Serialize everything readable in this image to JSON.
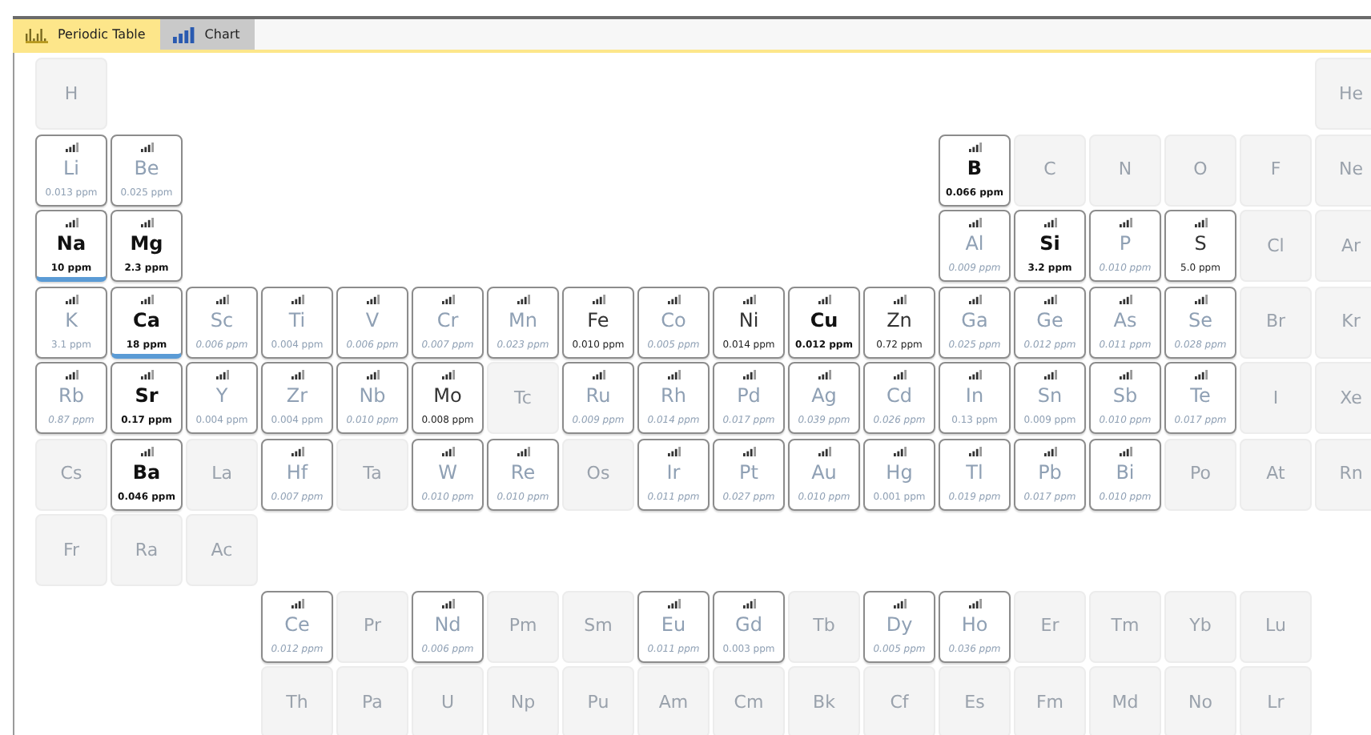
{
  "tabs": [
    {
      "label": "Periodic Table",
      "selected": true
    },
    {
      "label": "Chart",
      "selected": false
    }
  ],
  "periods": [
    {
      "left": [
        {
          "symbol": "H",
          "kind": "empty"
        }
      ],
      "right": [
        {
          "symbol": "He",
          "kind": "empty"
        }
      ]
    },
    {
      "left": [
        {
          "symbol": "Li",
          "kind": "plain",
          "value": "0.013 ppm"
        },
        {
          "symbol": "Be",
          "kind": "plain",
          "value": "0.025 ppm"
        }
      ],
      "right": [
        {
          "symbol": "B",
          "kind": "bold",
          "value": "0.066 ppm"
        },
        {
          "symbol": "C",
          "kind": "empty"
        },
        {
          "symbol": "N",
          "kind": "empty"
        },
        {
          "symbol": "O",
          "kind": "empty"
        },
        {
          "symbol": "F",
          "kind": "empty"
        },
        {
          "symbol": "Ne",
          "kind": "empty"
        }
      ]
    },
    {
      "left": [
        {
          "symbol": "Na",
          "kind": "bold",
          "value": "10 ppm",
          "highlighted": true
        },
        {
          "symbol": "Mg",
          "kind": "bold",
          "value": "2.3 ppm"
        }
      ],
      "right": [
        {
          "symbol": "Al",
          "kind": "trace",
          "value": "0.009 ppm"
        },
        {
          "symbol": "Si",
          "kind": "bold",
          "value": "3.2 ppm"
        },
        {
          "symbol": "P",
          "kind": "trace",
          "value": "0.010 ppm"
        },
        {
          "symbol": "S",
          "kind": "dark",
          "value": "5.0 ppm"
        },
        {
          "symbol": "Cl",
          "kind": "empty"
        },
        {
          "symbol": "Ar",
          "kind": "empty"
        }
      ]
    },
    {
      "left": [
        {
          "symbol": "K",
          "kind": "plain",
          "value": "3.1 ppm"
        },
        {
          "symbol": "Ca",
          "kind": "bold",
          "value": "18 ppm",
          "highlighted": true
        },
        {
          "symbol": "Sc",
          "kind": "trace",
          "value": "0.006 ppm"
        },
        {
          "symbol": "Ti",
          "kind": "plain",
          "value": "0.004 ppm"
        },
        {
          "symbol": "V",
          "kind": "trace",
          "value": "0.006 ppm"
        },
        {
          "symbol": "Cr",
          "kind": "trace",
          "value": "0.007 ppm"
        },
        {
          "symbol": "Mn",
          "kind": "trace",
          "value": "0.023 ppm"
        },
        {
          "symbol": "Fe",
          "kind": "dark",
          "value": "0.010 ppm"
        },
        {
          "symbol": "Co",
          "kind": "trace",
          "value": "0.005 ppm"
        },
        {
          "symbol": "Ni",
          "kind": "dark",
          "value": "0.014 ppm"
        },
        {
          "symbol": "Cu",
          "kind": "bold",
          "value": "0.012 ppm"
        },
        {
          "symbol": "Zn",
          "kind": "dark",
          "value": "0.72 ppm"
        },
        {
          "symbol": "Ga",
          "kind": "trace",
          "value": "0.025 ppm"
        },
        {
          "symbol": "Ge",
          "kind": "trace",
          "value": "0.012 ppm"
        },
        {
          "symbol": "As",
          "kind": "trace",
          "value": "0.011 ppm"
        },
        {
          "symbol": "Se",
          "kind": "trace",
          "value": "0.028 ppm"
        },
        {
          "symbol": "Br",
          "kind": "empty"
        },
        {
          "symbol": "Kr",
          "kind": "empty"
        }
      ]
    },
    {
      "left": [
        {
          "symbol": "Rb",
          "kind": "trace",
          "value": "0.87 ppm"
        },
        {
          "symbol": "Sr",
          "kind": "bold",
          "value": "0.17 ppm"
        },
        {
          "symbol": "Y",
          "kind": "plain",
          "value": "0.004 ppm"
        },
        {
          "symbol": "Zr",
          "kind": "plain",
          "value": "0.004 ppm"
        },
        {
          "symbol": "Nb",
          "kind": "trace",
          "value": "0.010 ppm"
        },
        {
          "symbol": "Mo",
          "kind": "dark",
          "value": "0.008 ppm"
        },
        {
          "symbol": "Tc",
          "kind": "empty"
        },
        {
          "symbol": "Ru",
          "kind": "trace",
          "value": "0.009 ppm"
        },
        {
          "symbol": "Rh",
          "kind": "trace",
          "value": "0.014 ppm"
        },
        {
          "symbol": "Pd",
          "kind": "trace",
          "value": "0.017 ppm"
        },
        {
          "symbol": "Ag",
          "kind": "trace",
          "value": "0.039 ppm"
        },
        {
          "symbol": "Cd",
          "kind": "trace",
          "value": "0.026 ppm"
        },
        {
          "symbol": "In",
          "kind": "plain",
          "value": "0.13 ppm"
        },
        {
          "symbol": "Sn",
          "kind": "plain",
          "value": "0.009 ppm"
        },
        {
          "symbol": "Sb",
          "kind": "trace",
          "value": "0.010 ppm"
        },
        {
          "symbol": "Te",
          "kind": "trace",
          "value": "0.017 ppm"
        },
        {
          "symbol": "I",
          "kind": "empty"
        },
        {
          "symbol": "Xe",
          "kind": "empty"
        }
      ]
    },
    {
      "left": [
        {
          "symbol": "Cs",
          "kind": "empty"
        },
        {
          "symbol": "Ba",
          "kind": "bold",
          "value": "0.046 ppm"
        },
        {
          "symbol": "La",
          "kind": "empty"
        },
        {
          "symbol": "Hf",
          "kind": "trace",
          "value": "0.007 ppm"
        },
        {
          "symbol": "Ta",
          "kind": "empty"
        },
        {
          "symbol": "W",
          "kind": "trace",
          "value": "0.010 ppm"
        },
        {
          "symbol": "Re",
          "kind": "trace",
          "value": "0.010 ppm"
        },
        {
          "symbol": "Os",
          "kind": "empty"
        },
        {
          "symbol": "Ir",
          "kind": "trace",
          "value": "0.011 ppm"
        },
        {
          "symbol": "Pt",
          "kind": "trace",
          "value": "0.027 ppm"
        },
        {
          "symbol": "Au",
          "kind": "trace",
          "value": "0.010 ppm"
        },
        {
          "symbol": "Hg",
          "kind": "plain",
          "value": "0.001 ppm"
        },
        {
          "symbol": "Tl",
          "kind": "trace",
          "value": "0.019 ppm"
        },
        {
          "symbol": "Pb",
          "kind": "trace",
          "value": "0.017 ppm"
        },
        {
          "symbol": "Bi",
          "kind": "trace",
          "value": "0.010 ppm"
        },
        {
          "symbol": "Po",
          "kind": "empty"
        },
        {
          "symbol": "At",
          "kind": "empty"
        },
        {
          "symbol": "Rn",
          "kind": "empty"
        }
      ]
    },
    {
      "left": [
        {
          "symbol": "Fr",
          "kind": "empty"
        },
        {
          "symbol": "Ra",
          "kind": "empty"
        },
        {
          "symbol": "Ac",
          "kind": "empty"
        }
      ]
    }
  ],
  "f_block": [
    [
      {
        "symbol": "Ce",
        "kind": "trace",
        "value": "0.012 ppm"
      },
      {
        "symbol": "Pr",
        "kind": "empty"
      },
      {
        "symbol": "Nd",
        "kind": "trace",
        "value": "0.006 ppm"
      },
      {
        "symbol": "Pm",
        "kind": "empty"
      },
      {
        "symbol": "Sm",
        "kind": "empty"
      },
      {
        "symbol": "Eu",
        "kind": "trace",
        "value": "0.011 ppm"
      },
      {
        "symbol": "Gd",
        "kind": "plain",
        "value": "0.003 ppm"
      },
      {
        "symbol": "Tb",
        "kind": "empty"
      },
      {
        "symbol": "Dy",
        "kind": "trace",
        "value": "0.005 ppm"
      },
      {
        "symbol": "Ho",
        "kind": "trace",
        "value": "0.036 ppm"
      },
      {
        "symbol": "Er",
        "kind": "empty"
      },
      {
        "symbol": "Tm",
        "kind": "empty"
      },
      {
        "symbol": "Yb",
        "kind": "empty"
      },
      {
        "symbol": "Lu",
        "kind": "empty"
      }
    ],
    [
      {
        "symbol": "Th",
        "kind": "empty"
      },
      {
        "symbol": "Pa",
        "kind": "empty"
      },
      {
        "symbol": "U",
        "kind": "empty"
      },
      {
        "symbol": "Np",
        "kind": "empty"
      },
      {
        "symbol": "Pu",
        "kind": "empty"
      },
      {
        "symbol": "Am",
        "kind": "empty"
      },
      {
        "symbol": "Cm",
        "kind": "empty"
      },
      {
        "symbol": "Bk",
        "kind": "empty"
      },
      {
        "symbol": "Cf",
        "kind": "empty"
      },
      {
        "symbol": "Es",
        "kind": "empty"
      },
      {
        "symbol": "Fm",
        "kind": "empty"
      },
      {
        "symbol": "Md",
        "kind": "empty"
      },
      {
        "symbol": "No",
        "kind": "empty"
      },
      {
        "symbol": "Lr",
        "kind": "empty"
      }
    ]
  ]
}
